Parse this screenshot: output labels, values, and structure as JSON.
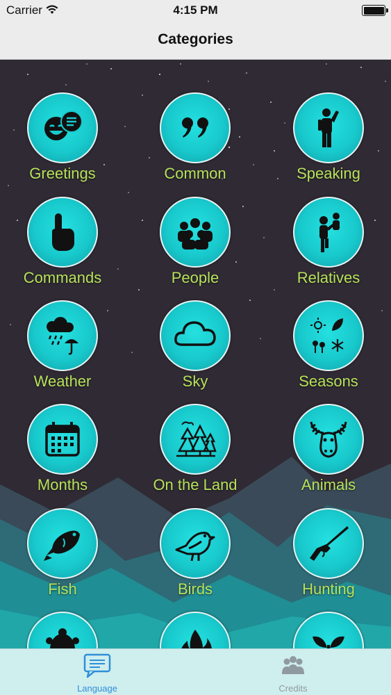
{
  "status_bar": {
    "carrier": "Carrier",
    "time": "4:15 PM"
  },
  "nav": {
    "title": "Categories"
  },
  "categories": [
    {
      "label": "Greetings",
      "icon": "greetings-icon"
    },
    {
      "label": "Common",
      "icon": "quote-icon"
    },
    {
      "label": "Speaking",
      "icon": "speaking-person-icon"
    },
    {
      "label": "Commands",
      "icon": "pointing-hand-icon"
    },
    {
      "label": "People",
      "icon": "people-group-icon"
    },
    {
      "label": "Relatives",
      "icon": "parent-child-icon"
    },
    {
      "label": "Weather",
      "icon": "rain-umbrella-icon"
    },
    {
      "label": "Sky",
      "icon": "cloud-icon"
    },
    {
      "label": "Seasons",
      "icon": "seasons-icon"
    },
    {
      "label": "Months",
      "icon": "calendar-icon"
    },
    {
      "label": "On the Land",
      "icon": "forest-icon"
    },
    {
      "label": "Animals",
      "icon": "moose-icon"
    },
    {
      "label": "Fish",
      "icon": "fish-icon"
    },
    {
      "label": "Birds",
      "icon": "bird-icon"
    },
    {
      "label": "Hunting",
      "icon": "rifle-icon"
    },
    {
      "label": "",
      "icon": "turtle-icon"
    },
    {
      "label": "",
      "icon": "fire-icon"
    },
    {
      "label": "",
      "icon": "sprout-icon"
    }
  ],
  "tabs": [
    {
      "label": "Language",
      "icon": "chat-bubble-icon",
      "selected": true
    },
    {
      "label": "Credits",
      "icon": "people-icon",
      "selected": false
    }
  ],
  "colors": {
    "accent": "#2f8fd8",
    "label_green": "#b7e25a",
    "circle_teal": "#18c9cc",
    "background": "#2f2a34"
  }
}
